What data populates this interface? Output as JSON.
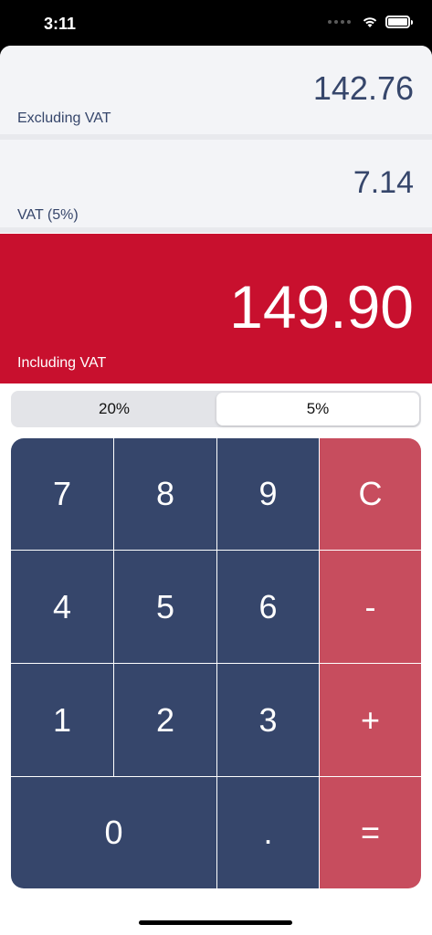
{
  "status_bar": {
    "time": "3:11"
  },
  "display": {
    "excluding": {
      "value": "142.76",
      "label": "Excluding VAT"
    },
    "vat": {
      "value": "7.14",
      "label": "VAT (5%)"
    },
    "including": {
      "value": "149.90",
      "label": "Including VAT"
    }
  },
  "rates": {
    "options": [
      "20%",
      "5%"
    ],
    "selected": "5%"
  },
  "keypad": {
    "k7": "7",
    "k8": "8",
    "k9": "9",
    "clear": "C",
    "k4": "4",
    "k5": "5",
    "k6": "6",
    "minus": "-",
    "k1": "1",
    "k2": "2",
    "k3": "3",
    "plus": "+",
    "k0": "0",
    "dot": ".",
    "equals": "="
  },
  "colors": {
    "primary": "#36466b",
    "accent": "#c8102e",
    "operator": "#c74d5e"
  }
}
